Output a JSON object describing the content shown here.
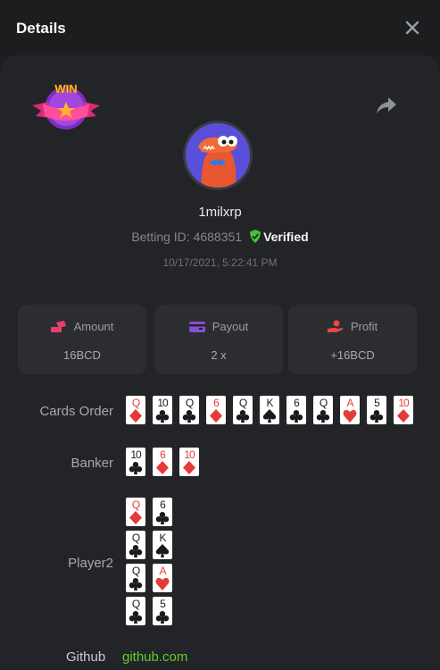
{
  "dialog": {
    "title": "Details"
  },
  "icons": {
    "close": "close-icon",
    "share": "share-icon",
    "badge": "win-badge"
  },
  "user": {
    "name": "1milxrp",
    "betting_label": "Betting ID: 4688351",
    "verified_label": "Verified",
    "date": "10/17/2021, 5:22:41 PM"
  },
  "stats": [
    {
      "label": "Amount",
      "value": "16BCD",
      "icon": "coins-icon"
    },
    {
      "label": "Payout",
      "value": "2 x",
      "icon": "wallet-icon"
    },
    {
      "label": "Profit",
      "value": "+16BCD",
      "icon": "profit-hand-icon"
    }
  ],
  "rows": {
    "cards_order": "Cards Order",
    "banker": "Banker",
    "player": "Player2"
  },
  "cards_order": [
    {
      "rank": "Q",
      "suit": "diamond"
    },
    {
      "rank": "10",
      "suit": "club"
    },
    {
      "rank": "Q",
      "suit": "club"
    },
    {
      "rank": "6",
      "suit": "diamond"
    },
    {
      "rank": "Q",
      "suit": "club"
    },
    {
      "rank": "K",
      "suit": "spade"
    },
    {
      "rank": "6",
      "suit": "club"
    },
    {
      "rank": "Q",
      "suit": "club"
    },
    {
      "rank": "A",
      "suit": "heart"
    },
    {
      "rank": "5",
      "suit": "club"
    },
    {
      "rank": "10",
      "suit": "diamond"
    }
  ],
  "banker_cards": [
    {
      "rank": "10",
      "suit": "club"
    },
    {
      "rank": "6",
      "suit": "diamond"
    },
    {
      "rank": "10",
      "suit": "diamond"
    }
  ],
  "player_cards": [
    {
      "rank": "Q",
      "suit": "diamond"
    },
    {
      "rank": "6",
      "suit": "club"
    },
    {
      "rank": "Q",
      "suit": "club"
    },
    {
      "rank": "K",
      "suit": "spade"
    },
    {
      "rank": "Q",
      "suit": "club"
    },
    {
      "rank": "A",
      "suit": "heart"
    },
    {
      "rank": "Q",
      "suit": "club"
    },
    {
      "rank": "5",
      "suit": "club"
    }
  ],
  "github": {
    "label": "Github",
    "link": "github.com"
  },
  "colors": {
    "accent_green": "#5fcf2d",
    "red_suit": "#e53a3a",
    "verified_shield": "#3fc33a",
    "profit_icon": "#e84545",
    "amount_icon": "#e8406c",
    "payout_icon": "#8a4bd8"
  }
}
